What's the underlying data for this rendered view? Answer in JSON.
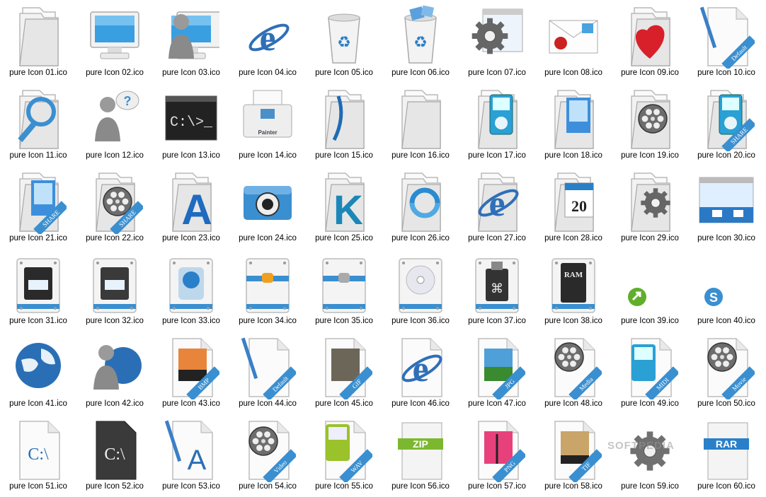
{
  "files": [
    {
      "name": "pure Icon 01.ico",
      "icon": "blank-folder-icon"
    },
    {
      "name": "pure Icon 02.ico",
      "icon": "monitor-icon"
    },
    {
      "name": "pure Icon 03.ico",
      "icon": "user-computer-icon"
    },
    {
      "name": "pure Icon 04.ico",
      "icon": "internet-explorer-icon"
    },
    {
      "name": "pure Icon 05.ico",
      "icon": "recycle-bin-empty-icon"
    },
    {
      "name": "pure Icon 06.ico",
      "icon": "recycle-bin-full-icon"
    },
    {
      "name": "pure Icon 07.ico",
      "icon": "control-panel-gear-icon"
    },
    {
      "name": "pure Icon 08.ico",
      "icon": "mail-envelope-icon"
    },
    {
      "name": "pure Icon 09.ico",
      "icon": "favorites-heart-folder-icon"
    },
    {
      "name": "pure Icon 10.ico",
      "icon": "default-document-pencil-icon"
    },
    {
      "name": "pure Icon 11.ico",
      "icon": "search-folder-icon"
    },
    {
      "name": "pure Icon 12.ico",
      "icon": "help-user-icon"
    },
    {
      "name": "pure Icon 13.ico",
      "icon": "command-prompt-icon"
    },
    {
      "name": "pure Icon 14.ico",
      "icon": "printer-icon"
    },
    {
      "name": "pure Icon 15.ico",
      "icon": "bookmark-folder-icon"
    },
    {
      "name": "pure Icon 16.ico",
      "icon": "open-folder-icon"
    },
    {
      "name": "pure Icon 17.ico",
      "icon": "music-player-folder-icon"
    },
    {
      "name": "pure Icon 18.ico",
      "icon": "pictures-folder-icon"
    },
    {
      "name": "pure Icon 19.ico",
      "icon": "video-folder-icon"
    },
    {
      "name": "pure Icon 20.ico",
      "icon": "shared-music-folder-icon"
    },
    {
      "name": "pure Icon 21.ico",
      "icon": "shared-pictures-folder-icon"
    },
    {
      "name": "pure Icon 22.ico",
      "icon": "shared-video-folder-icon"
    },
    {
      "name": "pure Icon 23.ico",
      "icon": "fonts-folder-icon"
    },
    {
      "name": "pure Icon 24.ico",
      "icon": "camera-icon"
    },
    {
      "name": "pure Icon 25.ico",
      "icon": "k-folder-icon"
    },
    {
      "name": "pure Icon 26.ico",
      "icon": "sync-folder-icon"
    },
    {
      "name": "pure Icon 27.ico",
      "icon": "internet-folder-icon"
    },
    {
      "name": "pure Icon 28.ico",
      "icon": "calendar-folder-icon"
    },
    {
      "name": "pure Icon 29.ico",
      "icon": "settings-folder-icon"
    },
    {
      "name": "pure Icon 30.ico",
      "icon": "network-window-icon"
    },
    {
      "name": "pure Icon 31.ico",
      "icon": "floppy-drive-dark-icon"
    },
    {
      "name": "pure Icon 32.ico",
      "icon": "floppy-drive-icon"
    },
    {
      "name": "pure Icon 33.ico",
      "icon": "hard-drive-icon"
    },
    {
      "name": "pure Icon 34.ico",
      "icon": "drive-orange-icon"
    },
    {
      "name": "pure Icon 35.ico",
      "icon": "drive-gray-icon"
    },
    {
      "name": "pure Icon 36.ico",
      "icon": "cd-drive-icon"
    },
    {
      "name": "pure Icon 37.ico",
      "icon": "usb-drive-icon"
    },
    {
      "name": "pure Icon 38.ico",
      "icon": "ram-chip-icon"
    },
    {
      "name": "pure Icon 39.ico",
      "icon": "green-arrow-icon"
    },
    {
      "name": "pure Icon 40.ico",
      "icon": "blue-s-icon"
    },
    {
      "name": "pure Icon 41.ico",
      "icon": "globe-icon"
    },
    {
      "name": "pure Icon 42.ico",
      "icon": "network-user-icon"
    },
    {
      "name": "pure Icon 43.ico",
      "icon": "bmp-file-icon"
    },
    {
      "name": "pure Icon 44.ico",
      "icon": "default-file-icon"
    },
    {
      "name": "pure Icon 45.ico",
      "icon": "gif-file-icon"
    },
    {
      "name": "pure Icon 46.ico",
      "icon": "html-file-icon"
    },
    {
      "name": "pure Icon 47.ico",
      "icon": "jpg-file-icon"
    },
    {
      "name": "pure Icon 48.ico",
      "icon": "media-file-icon"
    },
    {
      "name": "pure Icon 49.ico",
      "icon": "midi-file-icon"
    },
    {
      "name": "pure Icon 50.ico",
      "icon": "movie-file-icon"
    },
    {
      "name": "pure Icon 51.ico",
      "icon": "batch-file-icon"
    },
    {
      "name": "pure Icon 52.ico",
      "icon": "command-file-icon"
    },
    {
      "name": "pure Icon 53.ico",
      "icon": "font-file-icon"
    },
    {
      "name": "pure Icon 54.ico",
      "icon": "video-file-icon"
    },
    {
      "name": "pure Icon 55.ico",
      "icon": "wav-file-icon"
    },
    {
      "name": "pure Icon 56.ico",
      "icon": "zip-file-icon"
    },
    {
      "name": "pure Icon 57.ico",
      "icon": "png-file-icon"
    },
    {
      "name": "pure Icon 58.ico",
      "icon": "tif-file-icon"
    },
    {
      "name": "pure Icon 59.ico",
      "icon": "gear-icon"
    },
    {
      "name": "pure Icon 60.ico",
      "icon": "rar-file-icon"
    }
  ],
  "badges": {
    "pure Icon 10.ico": "Default",
    "pure Icon 20.ico": "SHARE",
    "pure Icon 21.ico": "SHARE",
    "pure Icon 22.ico": "SHARE",
    "pure Icon 43.ico": "BMP",
    "pure Icon 44.ico": "Default",
    "pure Icon 45.ico": "GIF",
    "pure Icon 47.ico": "JPG",
    "pure Icon 48.ico": "Media",
    "pure Icon 49.ico": "MIDI",
    "pure Icon 50.ico": "Movie",
    "pure Icon 54.ico": "Video",
    "pure Icon 55.ico": "WAV",
    "pure Icon 57.ico": "PNG",
    "pure Icon 58.ico": "TIF"
  },
  "glyphs": {
    "pure Icon 04.ico": "e",
    "pure Icon 13.ico": "C:\\>_",
    "pure Icon 14.ico": "Painter",
    "pure Icon 23.ico": "A",
    "pure Icon 25.ico": "K",
    "pure Icon 27.ico": "e",
    "pure Icon 28.ico": "20",
    "pure Icon 38.ico": "RAM",
    "pure Icon 40.ico": "S",
    "pure Icon 46.ico": "e",
    "pure Icon 51.ico": "C:\\",
    "pure Icon 52.ico": "C:\\",
    "pure Icon 53.ico": "A",
    "pure Icon 56.ico": "ZIP",
    "pure Icon 60.ico": "RAR"
  },
  "watermark": "SOFTPEDIA",
  "colors": {
    "accent": "#3a8fd0",
    "folder": "#f2f2f2",
    "folderEdge": "#b9b9b9",
    "heart": "#d8202a",
    "ieBlue": "#2f6fb8"
  }
}
